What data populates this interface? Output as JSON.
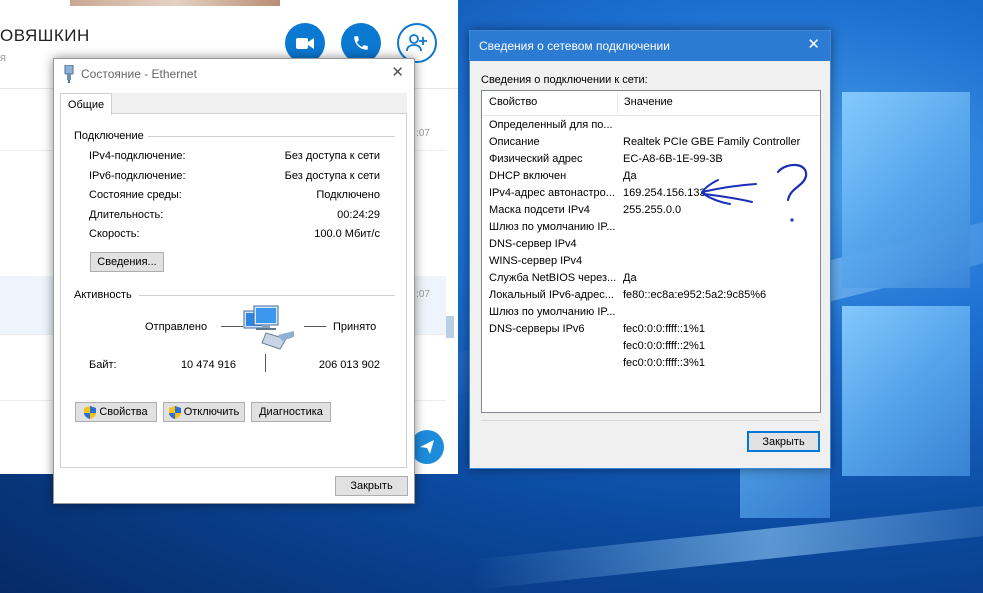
{
  "skype": {
    "contact_name": "ОВЯШКИН",
    "contact_sub": "я",
    "times": [
      ":07",
      ":07"
    ]
  },
  "ethernet": {
    "title": "Состояние - Ethernet",
    "tab": "Общие",
    "connection_group": "Подключение",
    "rows": [
      {
        "label": "IPv4-подключение:",
        "value": "Без доступа к сети"
      },
      {
        "label": "IPv6-подключение:",
        "value": "Без доступа к сети"
      },
      {
        "label": "Состояние среды:",
        "value": "Подключено"
      },
      {
        "label": "Длительность:",
        "value": "00:24:29"
      },
      {
        "label": "Скорость:",
        "value": "100.0 Мбит/с"
      }
    ],
    "details_button": "Сведения...",
    "activity_group": "Активность",
    "sent_label": "Отправлено",
    "received_label": "Принято",
    "bytes_label": "Байт:",
    "bytes_sent": "10 474 916",
    "bytes_received": "206 013 902",
    "properties_button": "Свойства",
    "disable_button": "Отключить",
    "diagnose_button": "Диагностика",
    "close_button": "Закрыть"
  },
  "details": {
    "title": "Сведения о сетевом подключении",
    "caption": "Сведения о подключении к сети:",
    "col_property": "Свойство",
    "col_value": "Значение",
    "rows": [
      {
        "p": "Определенный для по...",
        "v": ""
      },
      {
        "p": "Описание",
        "v": "Realtek PCIe GBE Family Controller"
      },
      {
        "p": "Физический адрес",
        "v": "EC-A8-6B-1E-99-3B"
      },
      {
        "p": "DHCP включен",
        "v": "Да"
      },
      {
        "p": "IPv4-адрес автонастро...",
        "v": "169.254.156.133"
      },
      {
        "p": "Маска подсети IPv4",
        "v": "255.255.0.0"
      },
      {
        "p": "Шлюз по умолчанию IP...",
        "v": ""
      },
      {
        "p": "DNS-сервер IPv4",
        "v": ""
      },
      {
        "p": "WINS-сервер IPv4",
        "v": ""
      },
      {
        "p": "Служба NetBIOS через...",
        "v": "Да"
      },
      {
        "p": "Локальный IPv6-адрес...",
        "v": "fe80::ec8a:e952:5a2:9c85%6"
      },
      {
        "p": "Шлюз по умолчанию IP...",
        "v": ""
      },
      {
        "p": "DNS-серверы IPv6",
        "v": "fec0:0:0:ffff::1%1"
      },
      {
        "p": "",
        "v": "fec0:0:0:ffff::2%1"
      },
      {
        "p": "",
        "v": "fec0:0:0:ffff::3%1"
      }
    ],
    "close_button": "Закрыть"
  },
  "colors": {
    "accent": "#0078d7",
    "titlebar_active": "#2b7bd3",
    "skype_blue": "#0b78d1"
  }
}
